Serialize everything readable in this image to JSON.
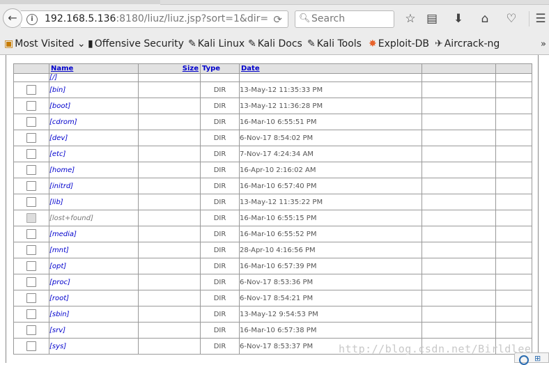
{
  "browser": {
    "url_host": "192.168.5.136",
    "url_rest": ":8180/liuz/liuz.jsp?sort=1&dir=",
    "search_placeholder": "Search"
  },
  "bookmarks": [
    {
      "label": "Most Visited",
      "icon": "folder-icon"
    },
    {
      "label": "Offensive Security",
      "icon": "offsec-icon"
    },
    {
      "label": "Kali Linux",
      "icon": "kali-icon"
    },
    {
      "label": "Kali Docs",
      "icon": "kali-icon"
    },
    {
      "label": "Kali Tools",
      "icon": "kali-icon"
    },
    {
      "label": "Exploit-DB",
      "icon": "exploitdb-icon"
    },
    {
      "label": "Aircrack-ng",
      "icon": "aircrack-icon"
    }
  ],
  "table": {
    "headers": {
      "name": "Name",
      "size": "Size",
      "type": "Type",
      "date": "Date"
    },
    "parent": "[/]",
    "rows": [
      {
        "name": "[bin]",
        "type": "DIR",
        "date": "13-May-12 11:35:33 PM"
      },
      {
        "name": "[boot]",
        "type": "DIR",
        "date": "13-May-12 11:36:28 PM"
      },
      {
        "name": "[cdrom]",
        "type": "DIR",
        "date": "16-Mar-10 6:55:51 PM"
      },
      {
        "name": "[dev]",
        "type": "DIR",
        "date": "6-Nov-17 8:54:02 PM"
      },
      {
        "name": "[etc]",
        "type": "DIR",
        "date": "7-Nov-17 4:24:34 AM"
      },
      {
        "name": "[home]",
        "type": "DIR",
        "date": "16-Apr-10 2:16:02 AM"
      },
      {
        "name": "[initrd]",
        "type": "DIR",
        "date": "16-Mar-10 6:57:40 PM"
      },
      {
        "name": "[lib]",
        "type": "DIR",
        "date": "13-May-12 11:35:22 PM"
      },
      {
        "name": "[lost+found]",
        "type": "DIR",
        "date": "16-Mar-10 6:55:15 PM",
        "disabled": true
      },
      {
        "name": "[media]",
        "type": "DIR",
        "date": "16-Mar-10 6:55:52 PM"
      },
      {
        "name": "[mnt]",
        "type": "DIR",
        "date": "28-Apr-10 4:16:56 PM"
      },
      {
        "name": "[opt]",
        "type": "DIR",
        "date": "16-Mar-10 6:57:39 PM"
      },
      {
        "name": "[proc]",
        "type": "DIR",
        "date": "6-Nov-17 8:53:36 PM"
      },
      {
        "name": "[root]",
        "type": "DIR",
        "date": "6-Nov-17 8:54:21 PM"
      },
      {
        "name": "[sbin]",
        "type": "DIR",
        "date": "13-May-12 9:54:53 PM"
      },
      {
        "name": "[srv]",
        "type": "DIR",
        "date": "16-Mar-10 6:57:38 PM"
      },
      {
        "name": "[sys]",
        "type": "DIR",
        "date": "6-Nov-17 8:53:37 PM"
      }
    ]
  },
  "watermark": "http://blog.csdn.net/Birldlee"
}
